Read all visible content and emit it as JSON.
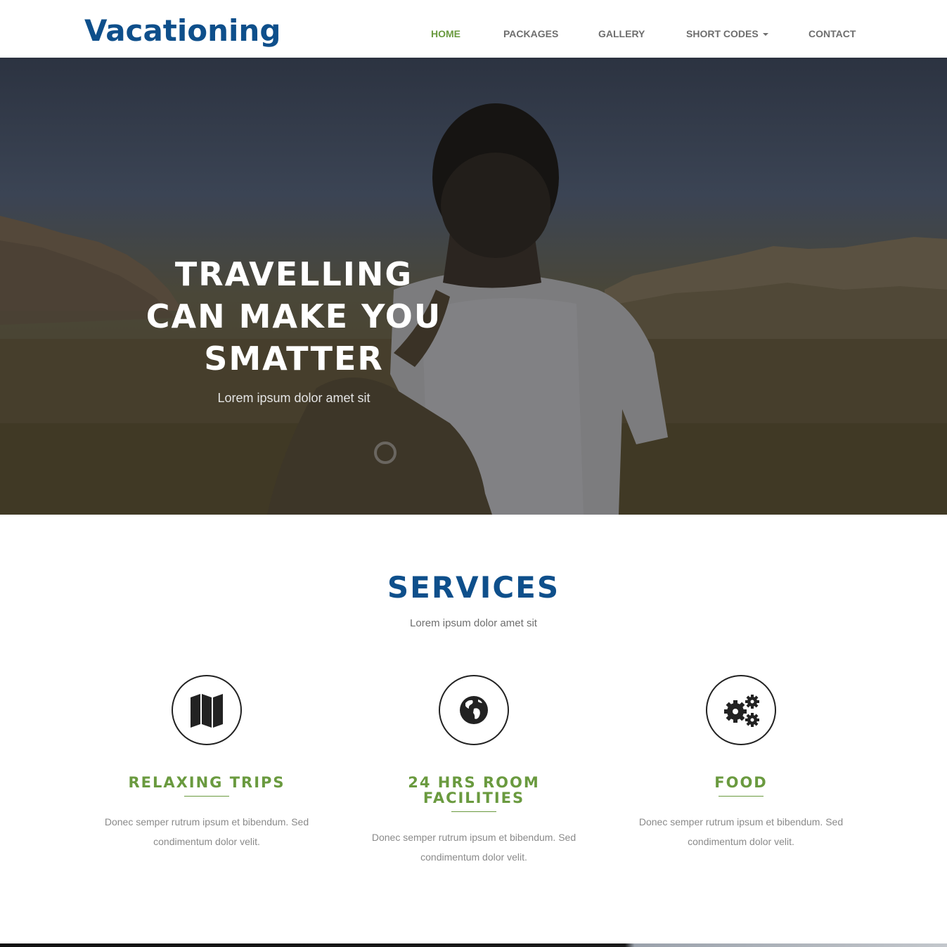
{
  "brand": {
    "logo_text": "Vacationing"
  },
  "nav": {
    "items": [
      {
        "label": "HOME",
        "active": true
      },
      {
        "label": "PACKAGES",
        "active": false
      },
      {
        "label": "GALLERY",
        "active": false
      },
      {
        "label": "SHORT CODES",
        "active": false,
        "has_dropdown": true
      },
      {
        "label": "CONTACT",
        "active": false
      }
    ]
  },
  "hero": {
    "title_lines": [
      "TRAVELLING",
      "CAN MAKE YOU",
      "SMATTER"
    ],
    "subtitle": "Lorem ipsum dolor amet sit"
  },
  "services": {
    "title": "SERVICES",
    "subtitle": "Lorem ipsum dolor amet sit",
    "items": [
      {
        "icon": "map-icon",
        "title": "RELAXING TRIPS",
        "text": "Donec semper rutrum ipsum et bibendum. Sed condimentum dolor velit."
      },
      {
        "icon": "globe-icon",
        "title": "24 HRS ROOM FACILITIES",
        "text": "Donec semper rutrum ipsum et bibendum. Sed condimentum dolor velit."
      },
      {
        "icon": "gears-icon",
        "title": "FOOD",
        "text": "Donec semper rutrum ipsum et bibendum. Sed condimentum dolor velit."
      }
    ]
  },
  "colors": {
    "brand_blue": "#0e4f8b",
    "accent_green": "#6a9a3f",
    "nav_gray": "#6e6e6e",
    "body_text": "#8a8a8a"
  }
}
